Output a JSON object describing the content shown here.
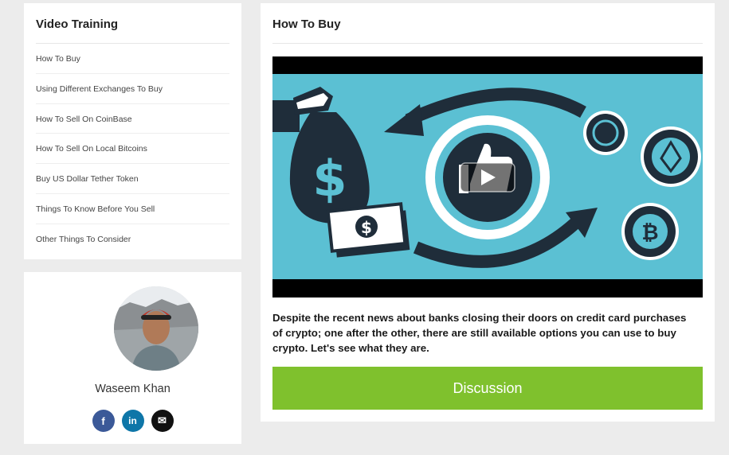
{
  "sidebar": {
    "title": "Video Training",
    "items": [
      {
        "label": "How To Buy"
      },
      {
        "label": "Using Different Exchanges To Buy"
      },
      {
        "label": "How To Sell On CoinBase"
      },
      {
        "label": "How To Sell On Local Bitcoins"
      },
      {
        "label": "Buy US Dollar Tether Token"
      },
      {
        "label": "Things To Know Before You Sell"
      },
      {
        "label": "Other Things To Consider"
      }
    ]
  },
  "author": {
    "name": "Waseem Khan",
    "socials": [
      {
        "icon": "facebook-icon",
        "glyph": "f"
      },
      {
        "icon": "linkedin-icon",
        "glyph": "in"
      },
      {
        "icon": "email-icon",
        "glyph": "✉"
      }
    ]
  },
  "main": {
    "title": "How To Buy",
    "description": "Despite the recent news about banks closing their doors on credit card purchases of crypto; one after the other, there are still available options you can use to buy crypto. Let's see what they are.",
    "discussion_label": "Discussion"
  },
  "colors": {
    "accent_green": "#7fc12d",
    "video_bg": "#5bc0d3",
    "dark_navy": "#1f2d3a"
  }
}
